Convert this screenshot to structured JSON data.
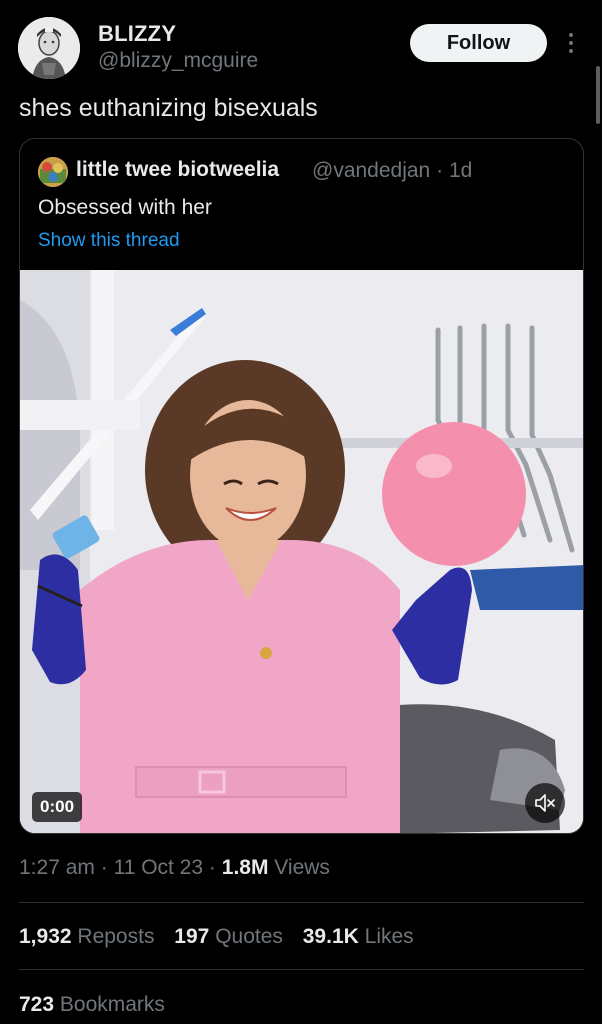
{
  "author": {
    "display_name": "BLIZZY",
    "handle": "@blizzy_mcguire",
    "avatar_icon": "profile-photo"
  },
  "follow_label": "Follow",
  "more_icon": "more-vertical-icon",
  "tweet_text": "shes euthanizing bisexuals",
  "quote": {
    "display_name": "little twee biotweelia",
    "handle": "@vandedjan",
    "separator": "·",
    "age": "1d",
    "text": "Obsessed with her",
    "thread_link": "Show this thread",
    "avatar_icon": "profile-photo"
  },
  "video": {
    "timecode": "0:00",
    "mute_icon": "muted-speaker-icon",
    "content": "video-still"
  },
  "timestamp": {
    "time": "1:27 am",
    "sep1": "·",
    "date": "11 Oct 23",
    "sep2": "·",
    "views_count": "1.8M",
    "views_label": "Views"
  },
  "stats": {
    "reposts_count": "1,932",
    "reposts_label": "Reposts",
    "quotes_count": "197",
    "quotes_label": "Quotes",
    "likes_count": "39.1K",
    "likes_label": "Likes"
  },
  "bookmarks": {
    "count": "723",
    "label": "Bookmarks"
  },
  "colors": {
    "background": "#000000",
    "link": "#1d9bf0",
    "muted_text": "#71767b",
    "primary_text": "#e7e9ea",
    "border": "#2f3336"
  }
}
